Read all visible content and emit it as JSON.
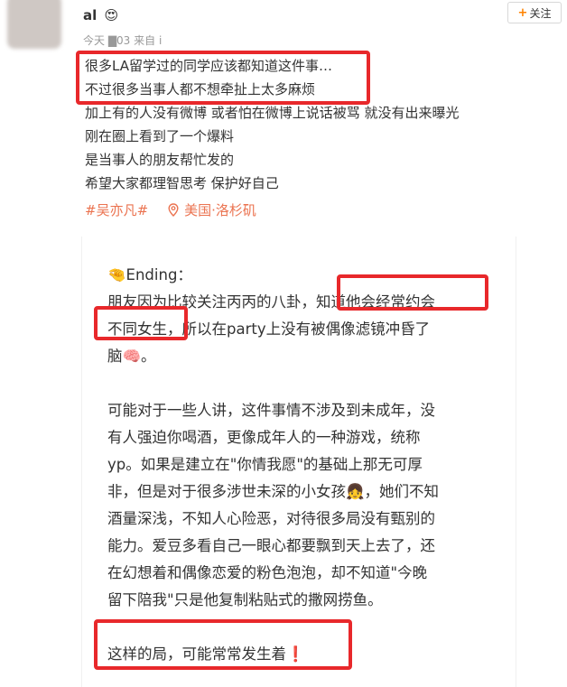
{
  "user": {
    "name": "al",
    "badge_icon": "starstruck-emoji-icon",
    "badge_glyph": "😍"
  },
  "follow_button": {
    "label": "关注",
    "plus": "+"
  },
  "meta": {
    "text": "今天 ▇03 来自 i"
  },
  "post": {
    "lines": [
      "很多LA留学过的同学应该都知道这件事…",
      "不过很多当事人都不想牵扯上太多麻烦",
      "加上有的人没有微博 或者怕在微博上说话被骂 就没有出来曝光",
      "刚在圈上看到了一个爆料",
      "是当事人的朋友帮忙发的",
      "希望大家都理智思考 保护好自己"
    ],
    "topic_tag": "#吴亦凡#",
    "location_icon": "location-pin-icon",
    "location": "美国·洛杉矶"
  },
  "image_card": {
    "lines": [
      "🤏Ending：",
      "朋友因为比较关注丙丙的八卦，知道他会经常约会",
      "不同女生，所以在party上没有被偶像滤镜冲昏了",
      "脑🧠。",
      "",
      "可能对于一些人讲，这件事情不涉及到未成年，没",
      "有人强迫你喝酒，更像成年人的一种游戏，统称",
      "yp。如果是建立在\"你情我愿\"的基础上那无可厚",
      "非，但是对于很多涉世未深的小女孩👧，她们不知",
      "酒量深浅，不知人心险恶，对待很多局没有甄别的",
      "能力。爱豆多看自己一眼心都要飘到天上去了，还",
      "在幻想着和偶像恋爱的粉色泡泡，却不知道\"今晚",
      "留下陪我\"只是他复制粘贴式的撒网捞鱼。",
      "",
      "这样的局，可能常常发生着❗"
    ]
  },
  "colors": {
    "highlight_box": "#e8282b",
    "tag": "#eb7350",
    "follow_plus": "#ff8200"
  }
}
